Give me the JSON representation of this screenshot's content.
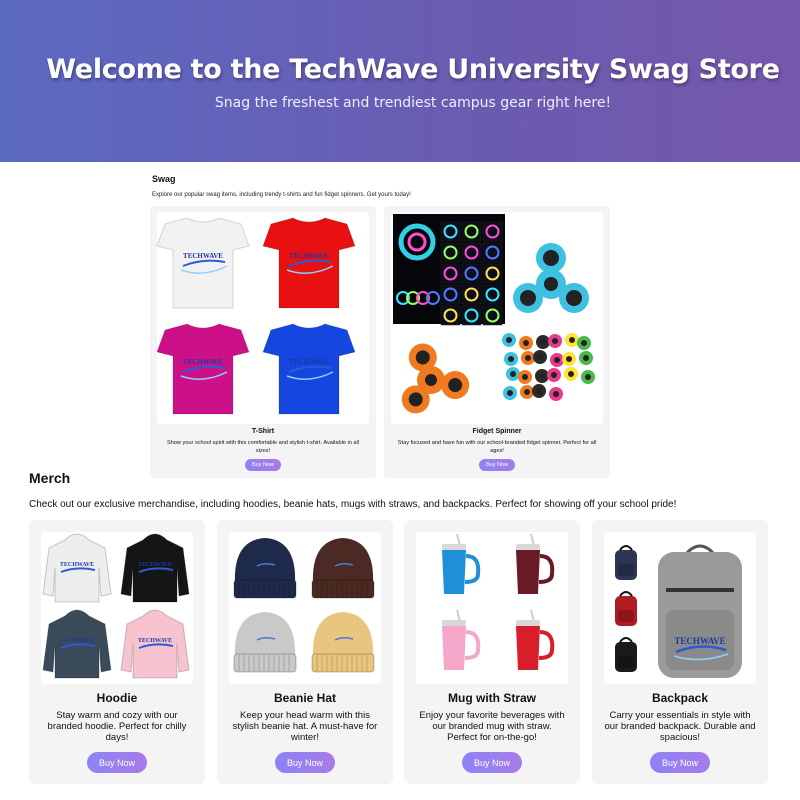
{
  "hero": {
    "title": "Welcome to the TechWave University Swag Store",
    "subtitle": "Snag the freshest and trendiest campus gear right here!"
  },
  "swag": {
    "title": "Swag",
    "description": "Explore our popular swag items, including trendy t-shirts and fun fidget spinners. Get yours today!",
    "items": [
      {
        "name": "T-Shirt",
        "description": "Show your school spirit with this comfortable and stylish t-shirt. Available in all sizes!",
        "button": "Buy Now",
        "logo_text": "TECHWAVE",
        "colors": [
          "#f2f2f2",
          "#e81010",
          "#cc1188",
          "#1546e0"
        ]
      },
      {
        "name": "Fidget Spinner",
        "description": "Stay focused and have fun with our school-branded fidget spinner. Perfect for all ages!",
        "button": "Buy Now",
        "colors": [
          "#3ec1e0",
          "#f07a20",
          "#2a2a2a",
          "#e83a8c",
          "#ffe23a",
          "#4bb84b"
        ]
      }
    ]
  },
  "merch": {
    "title": "Merch",
    "description": "Check out our exclusive merchandise, including hoodies, beanie hats, mugs with straws, and backpacks. Perfect for showing off your school pride!",
    "items": [
      {
        "name": "Hoodie",
        "description": "Stay warm and cozy with our branded hoodie. Perfect for chilly days!",
        "button": "Buy Now",
        "logo_text": "TECHWAVE",
        "colors": [
          "#eeeeee",
          "#151515",
          "#3a4a58",
          "#f6c3cf"
        ]
      },
      {
        "name": "Beanie Hat",
        "description": "Keep your head warm with this stylish beanie hat. A must-have for winter!",
        "button": "Buy Now",
        "colors": [
          "#1e2a4a",
          "#4a2a22",
          "#c9c9c9",
          "#e8c680"
        ]
      },
      {
        "name": "Mug with Straw",
        "description": "Enjoy your favorite beverages with our branded mug with straw. Perfect for on-the-go!",
        "button": "Buy Now",
        "colors": [
          "#1f8fd8",
          "#6a1a24",
          "#f4a7c8",
          "#d81e2a"
        ]
      },
      {
        "name": "Backpack",
        "description": "Carry your essentials in style with our branded backpack. Durable and spacious!",
        "button": "Buy Now",
        "logo_text": "TECHWAVE",
        "colors": [
          "#2c3554",
          "#b01c22",
          "#1a1a1a",
          "#9a9a9a"
        ]
      }
    ]
  }
}
